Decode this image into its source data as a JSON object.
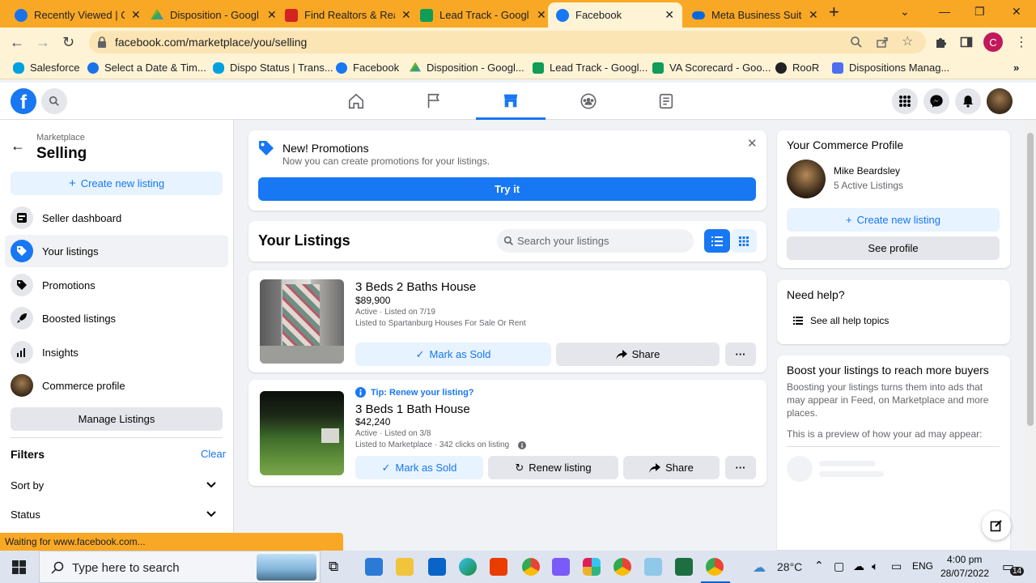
{
  "browser": {
    "tabs": [
      {
        "title": "Recently Viewed | C",
        "color": "#1a73e8"
      },
      {
        "title": "Disposition - Googl",
        "color": "#34a853"
      },
      {
        "title": "Find Realtors & Rea",
        "color": "#d32323"
      },
      {
        "title": "Lead Track - Googl",
        "color": "#0f9d58"
      },
      {
        "title": "Facebook",
        "color": "#1877f2"
      },
      {
        "title": "Meta Business Suite",
        "color": "#0668e1"
      }
    ],
    "url": "facebook.com/marketplace/you/selling",
    "profile_initial": "C",
    "bookmarks": [
      {
        "label": "Salesforce",
        "color": "#00a1e0"
      },
      {
        "label": "Select a Date & Tim...",
        "color": "#1a73e8"
      },
      {
        "label": "Dispo Status | Trans...",
        "color": "#00a1e0"
      },
      {
        "label": "Facebook",
        "color": "#1877f2"
      },
      {
        "label": "Disposition - Googl...",
        "color": "#34a853"
      },
      {
        "label": "Lead Track - Googl...",
        "color": "#0f9d58"
      },
      {
        "label": "VA Scorecard - Goo...",
        "color": "#0f9d58"
      },
      {
        "label": "RooR",
        "color": "#202124"
      },
      {
        "label": "Dispositions Manag...",
        "color": "#4e6ef2"
      }
    ]
  },
  "sidebar": {
    "breadcrumb": "Marketplace",
    "title": "Selling",
    "create_listing": "Create new listing",
    "items": [
      {
        "label": "Seller dashboard",
        "icon": "dashboard-icon"
      },
      {
        "label": "Your listings",
        "icon": "tag-icon"
      },
      {
        "label": "Promotions",
        "icon": "promotions-icon"
      },
      {
        "label": "Boosted listings",
        "icon": "rocket-icon"
      },
      {
        "label": "Insights",
        "icon": "bar-chart-icon"
      },
      {
        "label": "Commerce profile",
        "icon": "avatar"
      }
    ],
    "manage_listings": "Manage Listings",
    "filters_title": "Filters",
    "clear": "Clear",
    "sort_by": "Sort by",
    "status": "Status"
  },
  "promo": {
    "title": "New! Promotions",
    "subtitle": "Now you can create promotions for your listings.",
    "try_it": "Try it"
  },
  "listings_header": {
    "title": "Your Listings",
    "search_placeholder": "Search your listings"
  },
  "listings": [
    {
      "title": "3 Beds 2 Baths House",
      "price": "$89,900",
      "status": "Active · Listed on 7/19",
      "listed_to": "Listed to Spartanburg Houses For Sale Or Rent",
      "mark_sold": "Mark as Sold",
      "share": "Share"
    },
    {
      "tip": "Tip: Renew your listing?",
      "title": "3 Beds 1 Bath House",
      "price": "$42,240",
      "status": "Active · Listed on 3/8",
      "listed_to": "Listed to Marketplace · 342 clicks on listing",
      "mark_sold": "Mark as Sold",
      "renew": "Renew listing",
      "share": "Share"
    }
  ],
  "commerce_profile": {
    "title": "Your Commerce Profile",
    "name": "Mike Beardsley",
    "active": "5 Active Listings",
    "create_listing": "Create new listing",
    "see_profile": "See profile"
  },
  "help": {
    "title": "Need help?",
    "link": "See all help topics"
  },
  "boost": {
    "title": "Boost your listings to reach more buyers",
    "body": "Boosting your listings turns them into ads that may appear in Feed, on Marketplace and more places.",
    "preview": "This is a preview of how your ad may appear:"
  },
  "status_bar": "Waiting for www.facebook.com...",
  "taskbar": {
    "search_placeholder": "Type here to search",
    "temp": "28°C",
    "lang": "ENG",
    "time": "4:00 pm",
    "date": "28/07/2022",
    "notif": "14"
  },
  "colors": {
    "accent": "#1877f2",
    "chrome": "#f9a825"
  }
}
